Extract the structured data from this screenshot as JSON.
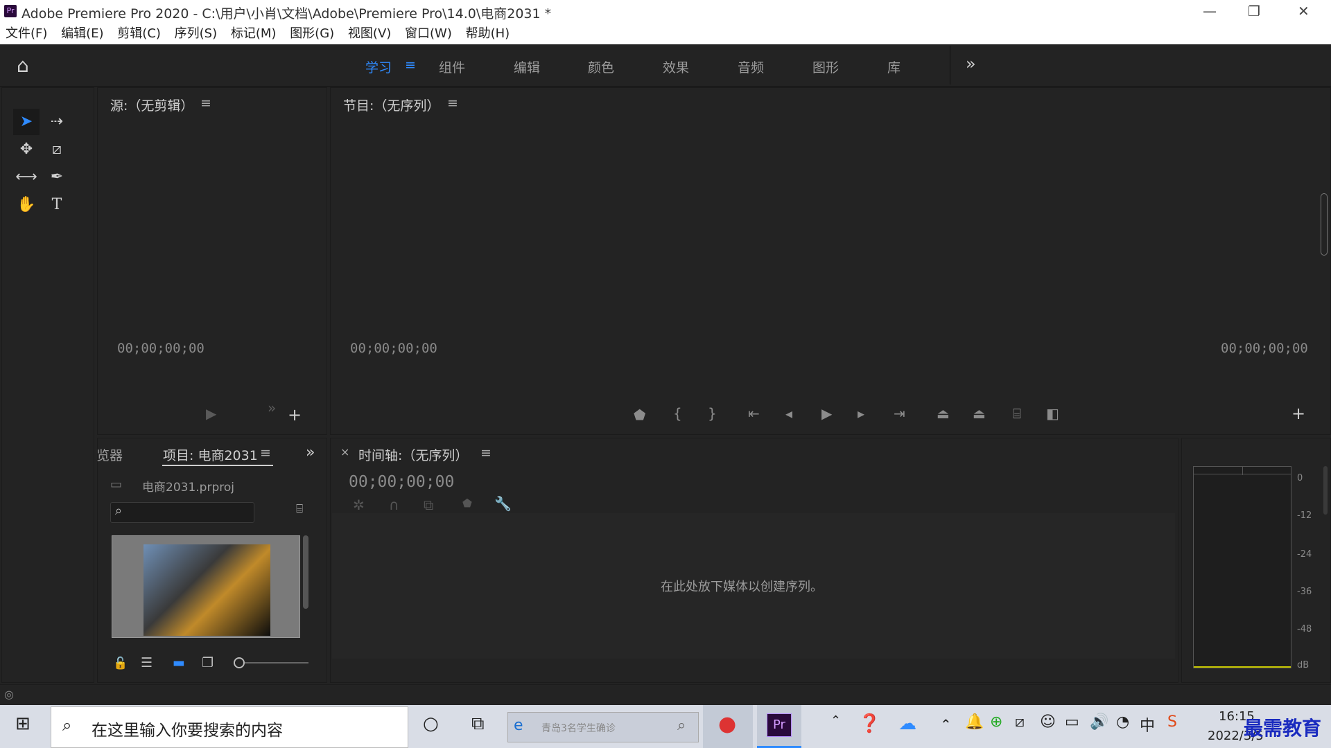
{
  "window": {
    "title": "Adobe Premiere Pro 2020 - C:\\用户\\小肖\\文档\\Adobe\\Premiere Pro\\14.0\\电商2031 *",
    "logo_text": "Pr"
  },
  "menu": [
    "文件(F)",
    "编辑(E)",
    "剪辑(C)",
    "序列(S)",
    "标记(M)",
    "图形(G)",
    "视图(V)",
    "窗口(W)",
    "帮助(H)"
  ],
  "workspaces": {
    "items": [
      "学习",
      "组件",
      "编辑",
      "颜色",
      "效果",
      "音频",
      "图形",
      "库"
    ],
    "active": "学习",
    "overflow": "»"
  },
  "source_panel": {
    "title": "源:（无剪辑）",
    "timecode": "00;00;00;00"
  },
  "program_panel": {
    "title": "节目:（无序列）",
    "timecode_left": "00;00;00;00",
    "timecode_right": "00;00;00;00"
  },
  "project_panel": {
    "prev_tab": "览器",
    "tab": "项目: 电商2031",
    "filename": "电商2031.prproj"
  },
  "timeline_panel": {
    "title": "时间轴:（无序列）",
    "timecode": "00;00;00;00",
    "empty_message": "在此处放下媒体以创建序列。"
  },
  "audio_meter": {
    "labels": [
      "0",
      "-12",
      "-24",
      "-36",
      "-48",
      "dB"
    ]
  },
  "taskbar": {
    "search_placeholder": "在这里输入你要搜索的内容",
    "browser_search": "青岛3名学生确诊",
    "clock_time": "16:15",
    "clock_date": "2022/3/5",
    "ime": "中",
    "watermark": "最需教育"
  },
  "colors": {
    "accent": "#2f8bff",
    "panel_bg": "#232323",
    "taskbar_bg": "#d9dde6"
  }
}
